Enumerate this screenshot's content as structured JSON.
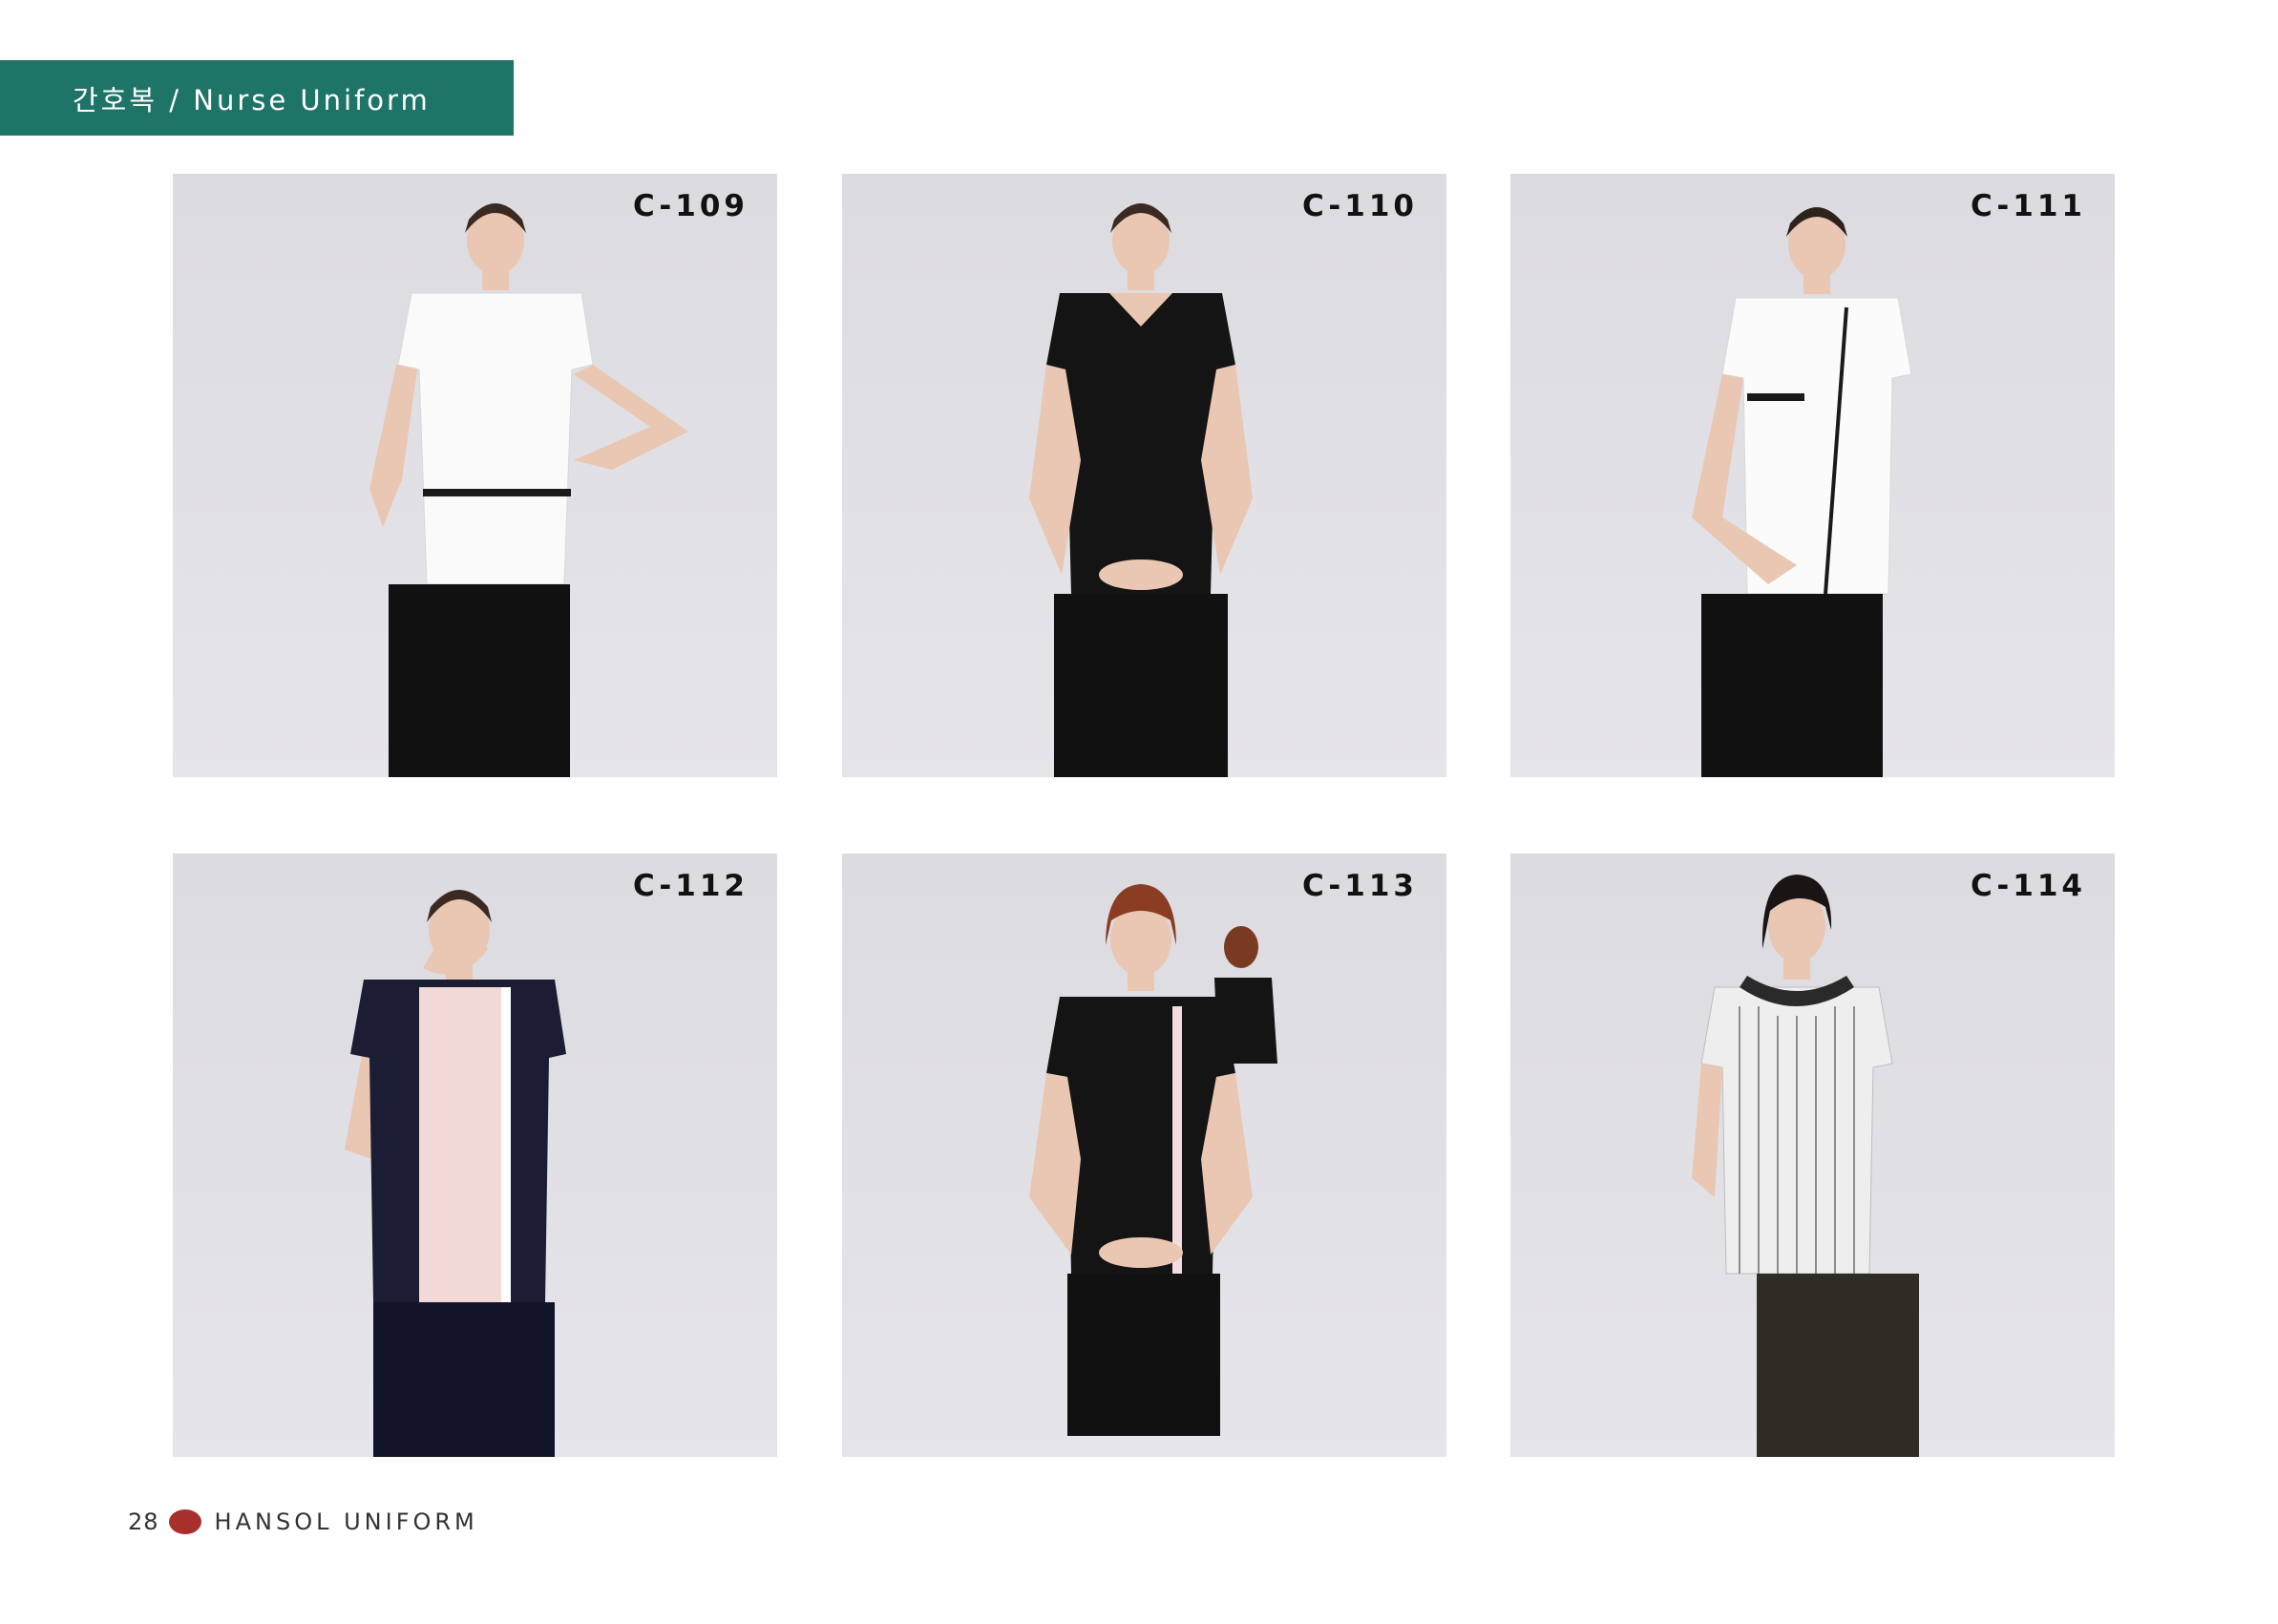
{
  "header": {
    "section_title": "간호복 / Nurse Uniform"
  },
  "products": [
    {
      "code": "C-109",
      "top": "white",
      "skirt": "black"
    },
    {
      "code": "C-110",
      "top": "black",
      "skirt": "black"
    },
    {
      "code": "C-111",
      "top": "white",
      "skirt": "black"
    },
    {
      "code": "C-112",
      "top": "navy-pink",
      "skirt": "navy"
    },
    {
      "code": "C-113",
      "top": "black",
      "skirt": "black"
    },
    {
      "code": "C-114",
      "top": "striped",
      "skirt": "dark-olive"
    }
  ],
  "footer": {
    "page_number": "28",
    "brand": "HANSOL UNIFORM"
  },
  "colors": {
    "banner": "#1e7466",
    "card_bg": "#dfdee3",
    "footer_dot": "#a8302c"
  }
}
